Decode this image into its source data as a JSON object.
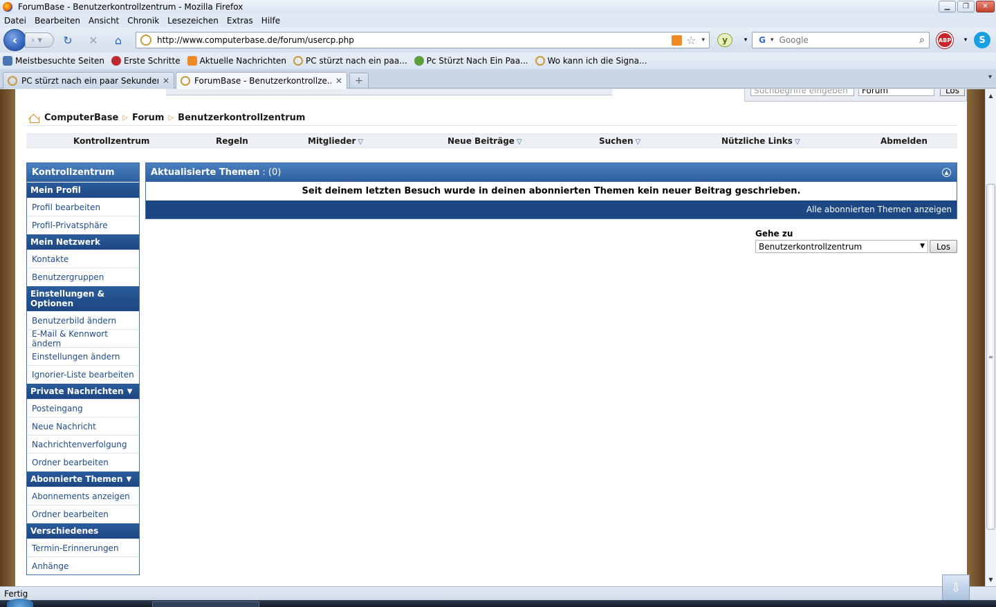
{
  "window": {
    "title": "ForumBase - Benutzerkontrollzentrum - Mozilla Firefox"
  },
  "menu": [
    "Datei",
    "Bearbeiten",
    "Ansicht",
    "Chronik",
    "Lesezeichen",
    "Extras",
    "Hilfe"
  ],
  "url": "http://www.computerbase.de/forum/usercp.php",
  "search": {
    "placeholder": "Google"
  },
  "bookmarks": [
    {
      "label": "Meistbesuchte Seiten",
      "icon": "search-folder-icon",
      "color": "#4a74b4"
    },
    {
      "label": "Erste Schritte",
      "icon": "firefox-icon",
      "color": "#c0282f"
    },
    {
      "label": "Aktuelle Nachrichten",
      "icon": "rss-icon",
      "color": "#f08a24"
    },
    {
      "label": "PC stürzt nach ein paa...",
      "icon": "site-icon",
      "color": "#c99a3d"
    },
    {
      "label": "Pc Stürzt Nach Ein Paa...",
      "icon": "bug-icon",
      "color": "#5aa03a"
    },
    {
      "label": "Wo kann ich die Signa...",
      "icon": "site-icon",
      "color": "#c99a3d"
    }
  ],
  "tabs": [
    {
      "label": "PC stürzt nach ein paar Sekunden a..."
    },
    {
      "label": "ForumBase - Benutzerkontrollze..."
    }
  ],
  "page": {
    "search_cut": {
      "placeholder": "Suchbegriffe eingeben",
      "scope": "Forum",
      "button": "Los"
    },
    "breadcrumb": [
      "ComputerBase",
      "Forum",
      "Benutzerkontrollzentrum"
    ],
    "nav": [
      {
        "label": "Kontrollzentrum",
        "dropdown": false
      },
      {
        "label": "Regeln",
        "dropdown": false
      },
      {
        "label": "Mitglieder",
        "dropdown": true
      },
      {
        "label": "Neue Beiträge",
        "dropdown": true
      },
      {
        "label": "Suchen",
        "dropdown": true
      },
      {
        "label": "Nützliche Links",
        "dropdown": true
      },
      {
        "label": "Abmelden",
        "dropdown": false
      }
    ],
    "sidebar": {
      "title": "Kontrollzentrum",
      "sections": [
        {
          "title": "Mein Profil",
          "arrow": false,
          "items": [
            "Profil bearbeiten",
            "Profil-Privatsphäre"
          ]
        },
        {
          "title": "Mein Netzwerk",
          "arrow": false,
          "items": [
            "Kontakte",
            "Benutzergruppen"
          ]
        },
        {
          "title": "Einstellungen & Optionen",
          "arrow": false,
          "items": [
            "Benutzerbild ändern",
            "E-Mail & Kennwort ändern",
            "Einstellungen ändern",
            "Ignorier-Liste bearbeiten"
          ]
        },
        {
          "title": "Private Nachrichten",
          "arrow": true,
          "items": [
            "Posteingang",
            "Neue Nachricht",
            "Nachrichtenverfolgung",
            "Ordner bearbeiten"
          ]
        },
        {
          "title": "Abonnierte Themen",
          "arrow": true,
          "items": [
            "Abonnements anzeigen",
            "Ordner bearbeiten"
          ]
        },
        {
          "title": "Verschiedenes",
          "arrow": false,
          "items": [
            "Termin-Erinnerungen",
            "Anhänge"
          ]
        }
      ]
    },
    "panel": {
      "title": "Aktualisierte Themen",
      "count": ": (0)",
      "message": "Seit deinem letzten Besuch wurde in deinen abonnierten Themen kein neuer Beitrag geschrieben.",
      "footer_link": "Alle abonnierten Themen anzeigen"
    },
    "goto": {
      "label": "Gehe zu",
      "selected": "Benutzerkontrollzentrum",
      "button": "Los"
    }
  },
  "status": "Fertig"
}
